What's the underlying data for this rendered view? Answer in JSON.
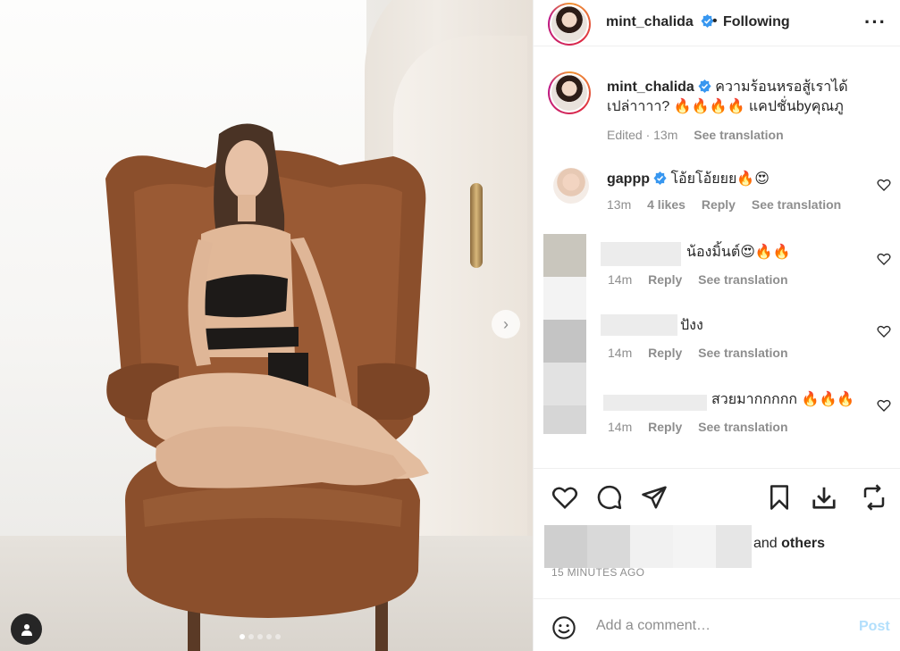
{
  "post": {
    "author": "mint_chalida",
    "follow_status": "Following",
    "caption": "ความร้อนหรอสู้เราได้เปล่าาาา? 🔥🔥🔥🔥 แคปชั่นbyคุณภู",
    "caption_line1": "ความร้อนหรอสู้เราได้",
    "caption_line2": "เปล่าาาา? 🔥🔥🔥🔥 แคปชั่นbyคุณภู",
    "caption_meta_edited": "Edited · 13m",
    "see_translation": "See translation",
    "carousel_total": 5,
    "carousel_current": 1
  },
  "comments": [
    {
      "username": "gappp",
      "verified": true,
      "text": "โอ้ยโอ้ยยย🔥😍",
      "time": "13m",
      "likes": "4 likes",
      "reply": "Reply",
      "see_translation": "See translation"
    },
    {
      "username": "",
      "text": "น้องมิ้นต์😍🔥🔥",
      "time": "14m",
      "reply": "Reply",
      "see_translation": "See translation"
    },
    {
      "username": "",
      "text": "ปังง",
      "time": "14m",
      "reply": "Reply",
      "see_translation": "See translation"
    },
    {
      "username": "",
      "text": "สวยมากกกกก 🔥🔥🔥",
      "time": "14m",
      "reply": "Reply",
      "see_translation": "See translation"
    }
  ],
  "actions": {
    "icons": [
      "heart-icon",
      "comment-icon",
      "share-icon",
      "save-icon",
      "download-icon",
      "repost-icon"
    ]
  },
  "likes_summary": {
    "suffix_plain": "and",
    "suffix_bold": "others"
  },
  "timestamp": "15 MINUTES AGO",
  "composer": {
    "placeholder": "Add a comment…",
    "post_label": "Post"
  },
  "colors": {
    "verified": "#3897f0",
    "post_disabled": "#b2dffc",
    "secondary_text": "#8e8e8e",
    "chair": "#8b4f2c"
  }
}
